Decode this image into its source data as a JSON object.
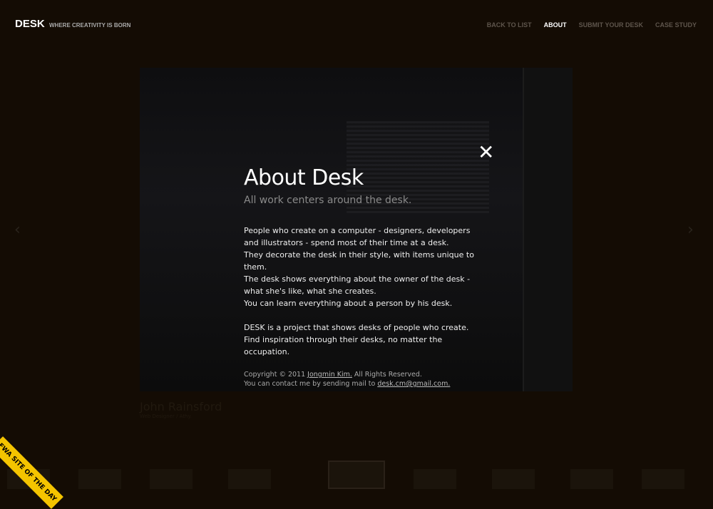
{
  "header": {
    "logo": "DESK",
    "tagline": "WHERE CREATIVITY IS BORN",
    "nav": [
      {
        "label": "BACK TO LIST"
      },
      {
        "label": "ABOUT",
        "active": true
      },
      {
        "label": "SUBMIT YOUR DESK"
      },
      {
        "label": "CASE STUDY"
      }
    ]
  },
  "modal": {
    "close_icon": "close-icon",
    "title": "About Desk",
    "subtitle": "All work centers around the desk.",
    "paragraph1": [
      "People who create on a computer - designers, developers and illustrators - spend most of their time at a desk.",
      "They decorate the desk in their style, with items unique to them.",
      "The desk shows everything about the owner of the desk - what she's like, what she creates.",
      "You can learn everything about a person by his desk."
    ],
    "paragraph2": [
      "DESK is a project that shows desks of people who create.",
      "Find inspiration through their desks, no matter the occupation."
    ],
    "copyright_prefix": "Copyright © 2011 ",
    "author": "Jongmin Kim.",
    "copyright_suffix": " All Rights Reserved.",
    "contact_prefix": "You can contact me by sending mail to ",
    "email": "desk.cm@gmail.com."
  },
  "background": {
    "person_name": "John Rainsford",
    "person_role": "Web Designer / Athy."
  },
  "badge": {
    "text": "FWA SITE OF THE DAY"
  }
}
